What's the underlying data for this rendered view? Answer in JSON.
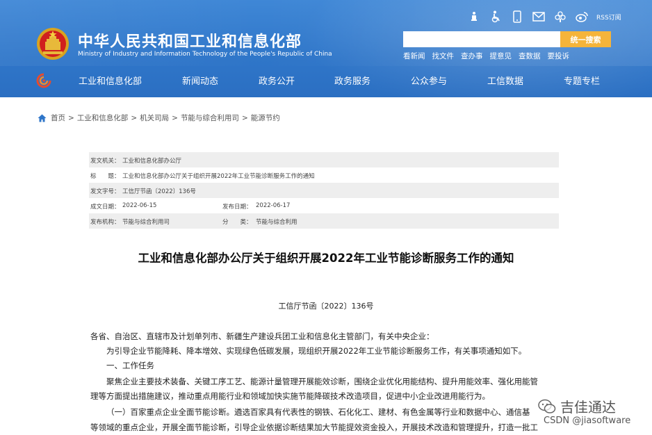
{
  "header": {
    "title": "中华人民共和国工业和信息化部",
    "subtitle": "Ministry of Industry and Information Technology of the People's Republic of China",
    "top_icons": [
      "accessibility-figure-icon",
      "wheelchair-icon",
      "mobile-icon",
      "mail-icon",
      "flower-icon",
      "weibo-icon"
    ],
    "rss_label": "RSS订阅",
    "search": {
      "placeholder": "",
      "button_label": "统一搜索"
    },
    "quick_links": [
      "看新闻",
      "找文件",
      "查办事",
      "提意见",
      "查数据",
      "要投诉"
    ]
  },
  "nav": {
    "items": [
      "工业和信息化部",
      "新闻动态",
      "政务公开",
      "政务服务",
      "公众参与",
      "工信数据",
      "专题专栏"
    ]
  },
  "breadcrumb": [
    "首页",
    "工业和信息化部",
    "机关司局",
    "节能与综合利用司",
    "能源节约"
  ],
  "info": {
    "issuer_label": "发文机关：",
    "issuer": "工业和信息化部办公厅",
    "title_label": "标　　题：",
    "title": "工业和信息化部办公厅关于组织开展2022年工业节能诊断服务工作的通知",
    "docnum_label": "发文字号：",
    "docnum": "工信厅节函〔2022〕136号",
    "written_label": "成文日期：",
    "written": "2022-06-15",
    "published_label": "发布日期：",
    "published": "2022-06-17",
    "org_label": "发布机构：",
    "org": "节能与综合利用司",
    "category_label": "分　　类：",
    "category": "节能与综合利用"
  },
  "article": {
    "title": "工业和信息化部办公厅关于组织开展2022年工业节能诊断服务工作的通知",
    "doc_no": "工信厅节函〔2022〕136号",
    "paragraphs": [
      "各省、自治区、直辖市及计划单列市、新疆生产建设兵团工业和信息化主管部门，有关中央企业：",
      "为引导企业节能降耗、降本增效、实现绿色低碳发展，现组织开展2022年工业节能诊断服务工作，有关事项通知如下。",
      "一、工作任务",
      "聚焦企业主要技术装备、关键工序工艺、能源计量管理开展能效诊断，围绕企业优化用能结构、提升用能效率、强化用能管",
      "理等方面提出措施建议，推动重点用能行业和领域加快实施节能降碳技术改造项目，促进中小企业改进用能行为。",
      "（一）百家重点企业全面节能诊断。遴选百家具有代表性的钢铁、石化化工、建材、有色金属等行业和数据中心、通信基",
      "等领域的重点企业，开展全面节能诊断，引导企业依据诊断结果加大节能提效资金投入，开展技术改造和管理提升，打造一批工"
    ]
  },
  "watermark": {
    "brand": "吉佳通达",
    "csdn": "CSDN @jiasoftware"
  },
  "colors": {
    "header_blue": "#2f76c9",
    "search_button": "#f5b43a",
    "table_shade": "#eeeeee"
  }
}
